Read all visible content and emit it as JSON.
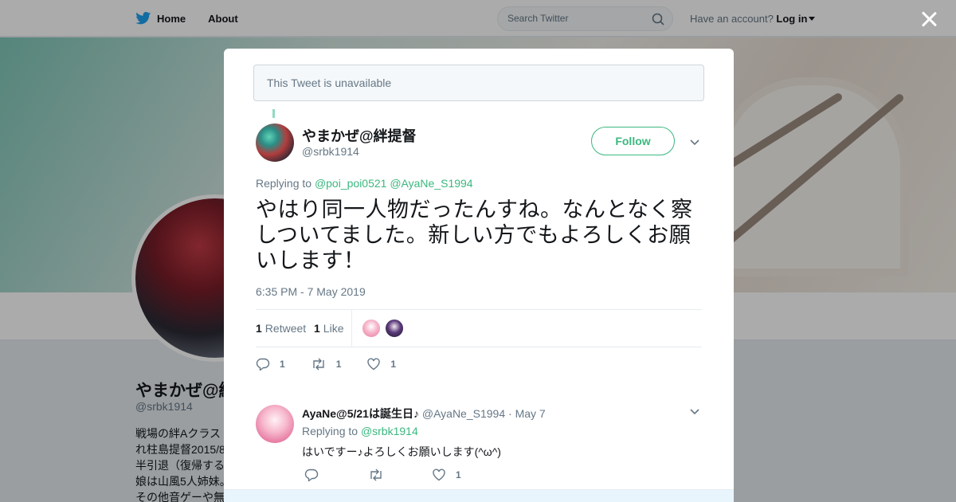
{
  "nav": {
    "home_label": "Home",
    "about_label": "About",
    "search_placeholder": "Search Twitter",
    "account_prompt": "Have an account?",
    "login_label": "Log in"
  },
  "profile_bg": {
    "name": "やまかぜ@絆",
    "handle": "@srbk1914",
    "bio": "戦場の絆Aクラス\nれ柱島提督2015/8\n半引退（復帰する\n娘は山風5人姉妹。\nその他音ゲーや無"
  },
  "modal": {
    "unavailable_text": "This Tweet is unavailable",
    "tweet": {
      "author_name": "やまかぜ@絆提督",
      "author_handle": "@srbk1914",
      "follow_label": "Follow",
      "replying_prefix": "Replying to",
      "replying_mentions": [
        "@poi_poi0521",
        "@AyaNe_S1994"
      ],
      "text": "やはり同一人物だったんすね。なんとなく察しついてました。新しい方でもよろしくお願いします！",
      "timestamp": "6:35 PM - 7 May 2019",
      "retweet_count": "1",
      "retweet_label": "Retweet",
      "like_count": "1",
      "like_label": "Like",
      "actions": {
        "reply_count": "1",
        "retweet_count": "1",
        "like_count": "1"
      }
    },
    "reply": {
      "author_name": "AyaNe@5/21は誕生日♪",
      "author_handle": "@AyaNe_S1994",
      "separator": "·",
      "date": "May 7",
      "replying_prefix": "Replying to",
      "replying_mention": "@srbk1914",
      "text": "はいですー♪よろしくお願いします(^ω^)",
      "like_count": "1"
    }
  },
  "colors": {
    "accent": "#3bb87f",
    "twitter_blue": "#1da1f2",
    "muted": "#657786"
  }
}
